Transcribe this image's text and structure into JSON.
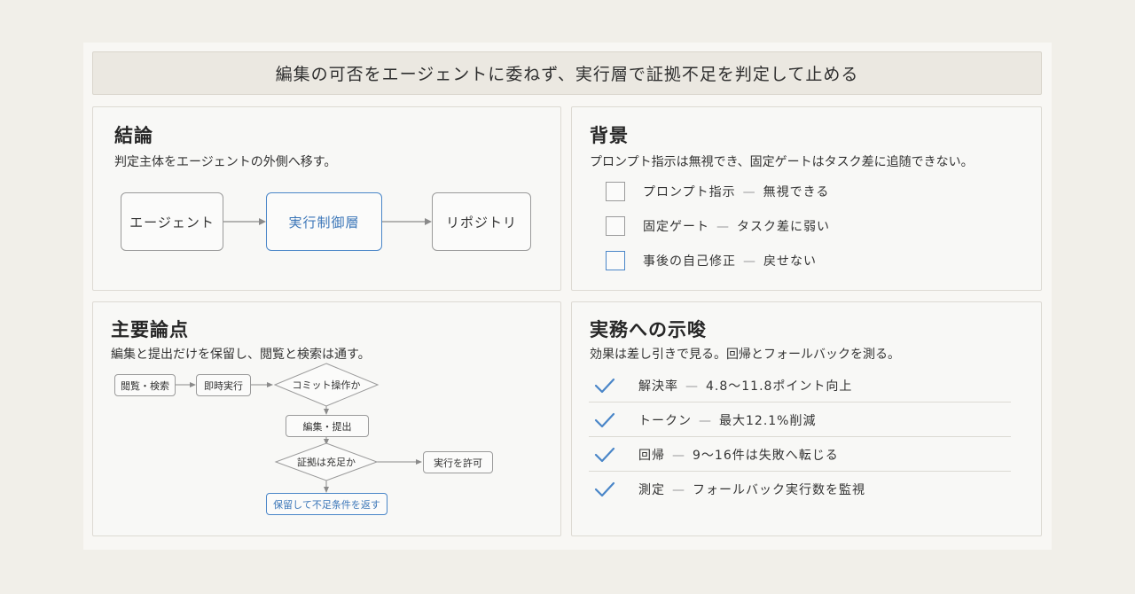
{
  "title": "編集の可否をエージェントに委ねず、実行層で証拠不足を判定して止める",
  "conclusion": {
    "heading": "結論",
    "subtitle": "判定主体をエージェントの外側へ移す。",
    "flow": [
      "エージェント",
      "実行制御層",
      "リポジトリ"
    ]
  },
  "background": {
    "heading": "背景",
    "subtitle": "プロンプト指示は無視でき、固定ゲートはタスク差に追随できない。",
    "items": [
      {
        "label": "プロンプト指示",
        "note": "無視できる"
      },
      {
        "label": "固定ゲート",
        "note": "タスク差に弱い"
      },
      {
        "label": "事後の自己修正",
        "note": "戻せない"
      }
    ],
    "separator": "—"
  },
  "main_points": {
    "heading": "主要論点",
    "subtitle": "編集と提出だけを保留し、閲覧と検索は通す。",
    "nodes": {
      "browse": "閲覧・検索",
      "immediate": "即時実行",
      "commit_q": "コミット操作か",
      "edit_submit": "編集・提出",
      "evidence_q": "証拠は充足か",
      "allow": "実行を許可",
      "hold": "保留して不足条件を返す"
    }
  },
  "implications": {
    "heading": "実務への示唆",
    "subtitle": "効果は差し引きで見る。回帰とフォールバックを測る。",
    "items": [
      {
        "label": "解決率",
        "note": "4.8〜11.8ポイント向上"
      },
      {
        "label": "トークン",
        "note": "最大12.1%削減"
      },
      {
        "label": "回帰",
        "note": "9〜16件は失敗へ転じる"
      },
      {
        "label": "測定",
        "note": "フォールバック実行数を監視"
      }
    ],
    "separator": "—"
  },
  "colors": {
    "accent": "#4a86c8",
    "connector": "#8a8a8a"
  }
}
